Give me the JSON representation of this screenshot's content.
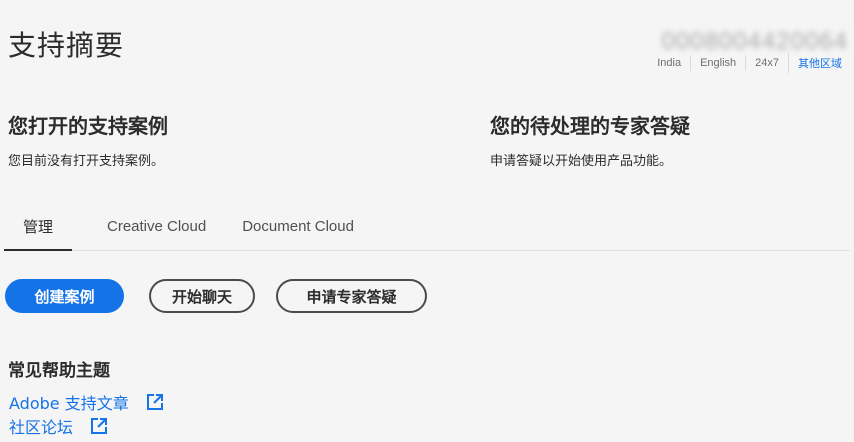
{
  "header": {
    "title": "支持摘要",
    "account_id": "0008004420064",
    "region": {
      "country": "India",
      "language": "English",
      "availability": "24x7",
      "other_regions_link": "其他区域"
    }
  },
  "summary": {
    "open_cases": {
      "heading": "您打开的支持案例",
      "message": "您目前没有打开支持案例。"
    },
    "expert_sessions": {
      "heading": "您的待处理的专家答疑",
      "message": "申请答疑以开始使用产品功能。"
    }
  },
  "tabs": [
    {
      "label": "管理",
      "active": true
    },
    {
      "label": "Creative Cloud",
      "active": false
    },
    {
      "label": "Document Cloud",
      "active": false
    }
  ],
  "actions": {
    "create_case": "创建案例",
    "start_chat": "开始聊天",
    "request_expert": "申请专家答疑"
  },
  "help": {
    "heading": "常见帮助主题",
    "links": [
      {
        "label": "Adobe 支持文章",
        "icon": "external-link-icon"
      },
      {
        "label": "社区论坛",
        "icon": "external-link-icon"
      }
    ]
  },
  "colors": {
    "accent": "#1473e6",
    "background": "#f5f5f5",
    "text": "#2c2c2c"
  }
}
